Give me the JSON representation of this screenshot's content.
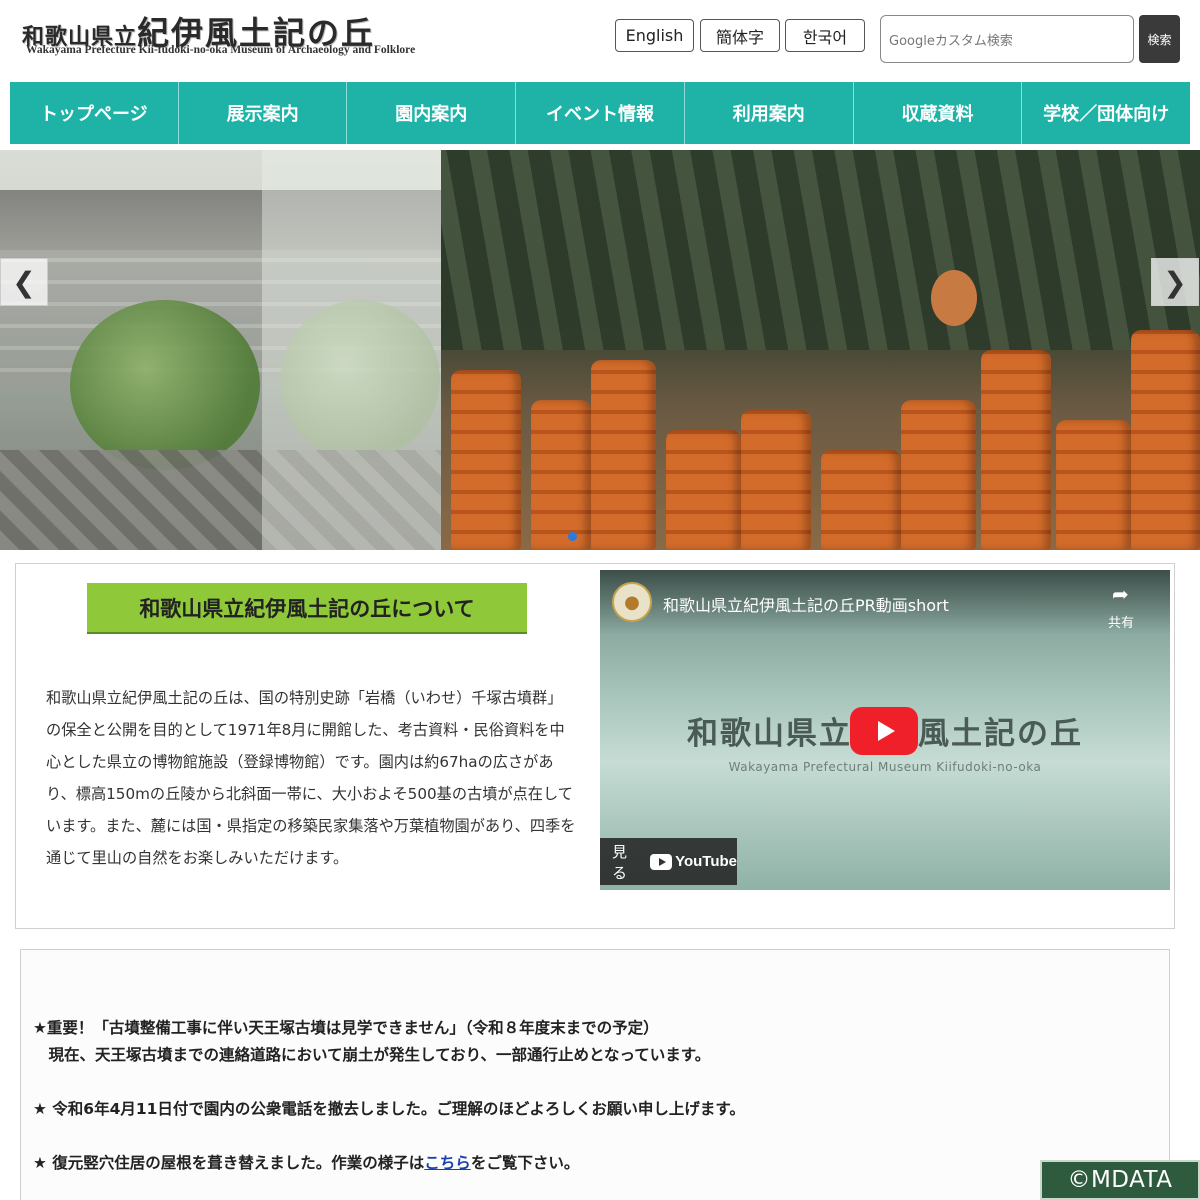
{
  "header": {
    "logo_small": "和歌山県立",
    "logo_big": "紀伊風土記の丘",
    "logo_sub": "Wakayama Prefecture Kii-fudoki-no-oka Museum of Archaeology and Folklore",
    "languages": [
      "English",
      "簡体字",
      "한국어"
    ],
    "search_placeholder": "Googleカスタム検索",
    "search_button": "検索"
  },
  "nav": {
    "items": [
      "トップページ",
      "展示案内",
      "園内案内",
      "イベント情報",
      "利用案内",
      "収蔵資料",
      "学校／団体向け"
    ]
  },
  "slider": {
    "prev_icon": "chevron-left-icon",
    "next_icon": "chevron-right-icon"
  },
  "about": {
    "title": "和歌山県立紀伊風土記の丘について",
    "text": "和歌山県立紀伊風土記の丘は、国の特別史跡「岩橋（いわせ）千塚古墳群」の保全と公開を目的として1971年8月に開館した、考古資料・民俗資料を中心とした県立の博物館施設（登録博物館）です。園内は約67haの広さがあり、標高150mの丘陵から北斜面一帯に、大小およそ500基の古墳が点在しています。また、麓には国・県指定の移築民家集落や万葉植物園があり、四季を通じて里山の自然をお楽しみいただけます。"
  },
  "video": {
    "title": "和歌山県立紀伊風土記の丘PR動画short",
    "share_label": "共有",
    "overlay_title": "和歌山県立紀伊風土記の丘",
    "overlay_subtitle": "Wakayama Prefectural Museum Kiifudoki-no-oka",
    "watch_label": "見る",
    "youtube_label": "YouTube"
  },
  "news": {
    "items": [
      "★重要！「古墳整備工事に伴い天王塚古墳は見学できません」（令和８年度末までの予定）",
      "　現在、天王塚古墳までの連絡道路において崩土が発生しており、一部通行止めとなっています。",
      "★ 令和6年4月11日付で園内の公衆電話を撤去しました。ご理解のほどよろしくお願い申し上げます。",
      "★ 復元竪穴住居の屋根を葺き替えました。作業の様子は"
    ],
    "link_text": "こちら",
    "link_suffix": "をご覧下さい。"
  },
  "copyright": "©MDATA",
  "colors": {
    "nav_bg": "#1fb3a8",
    "about_title_bg": "#8fc93a",
    "link": "#1a3fb0",
    "youtube_red": "#f0202a"
  }
}
